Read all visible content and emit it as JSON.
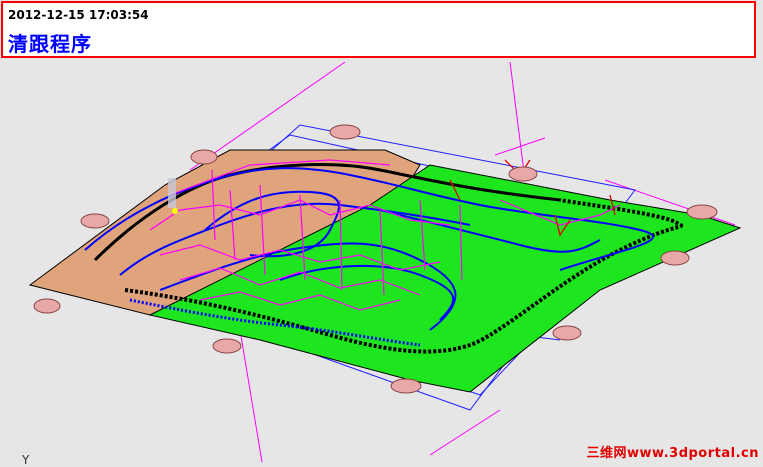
{
  "header": {
    "timestamp": "2012-12-15 17:03:54",
    "title": "清跟程序"
  },
  "viewport": {
    "axis_label": "Y",
    "watermark": "三维网www.3dportal.cn"
  },
  "colors": {
    "background": "#e6e6e6",
    "frame_border": "#ff0000",
    "title_text": "#0000ff",
    "die_surface_copper": "#e0a47c",
    "die_surface_green": "#1ee61e",
    "toolpath_blue": "#0000ff",
    "toolpath_magenta": "#ff00ff",
    "clamp_pad": "#e8a8a8"
  }
}
